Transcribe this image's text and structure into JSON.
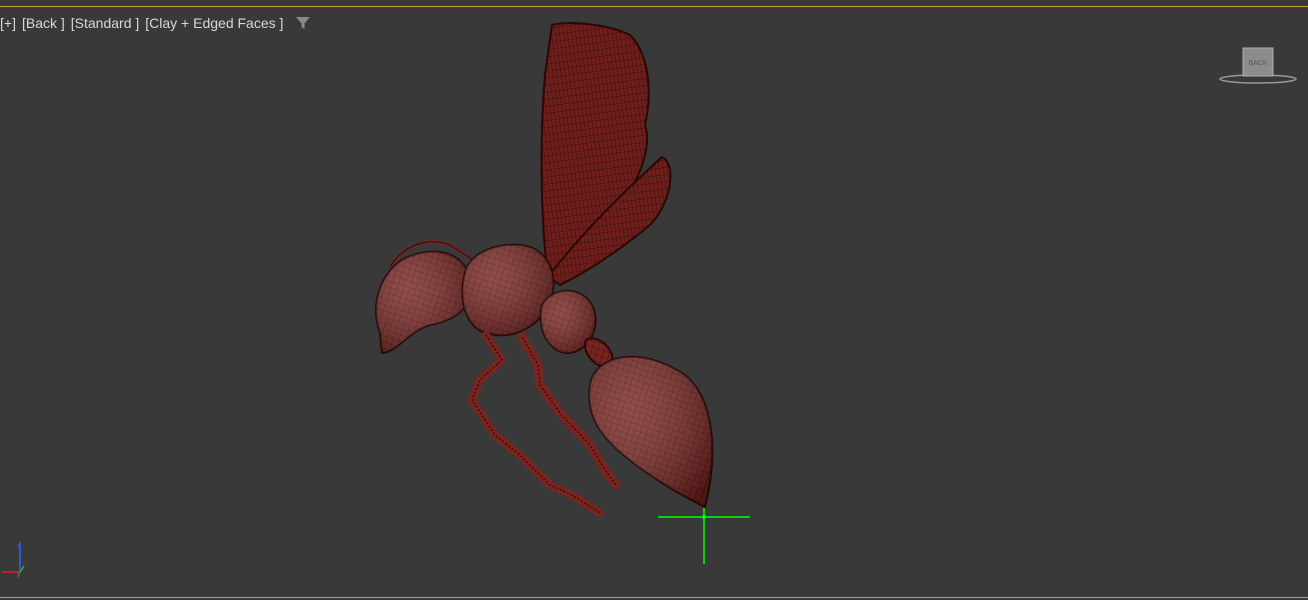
{
  "viewport": {
    "labels": [
      "[+]",
      "[Back ]",
      "[Standard ]",
      "[Clay + Edged Faces ]"
    ],
    "filter_icon": "funnel-filter-icon",
    "viewcube_face_label": "BACK"
  },
  "colors": {
    "background": "#393939",
    "active_border": "#c8a42a",
    "model_fill": "#7a2420",
    "model_wire": "#3a0c0a",
    "pivot": "#00ff00",
    "axis_x": "#e02020",
    "axis_y": "#20c020",
    "axis_z": "#3060ff"
  },
  "scene": {
    "object": "wasp model (red clay with edged faces)"
  }
}
